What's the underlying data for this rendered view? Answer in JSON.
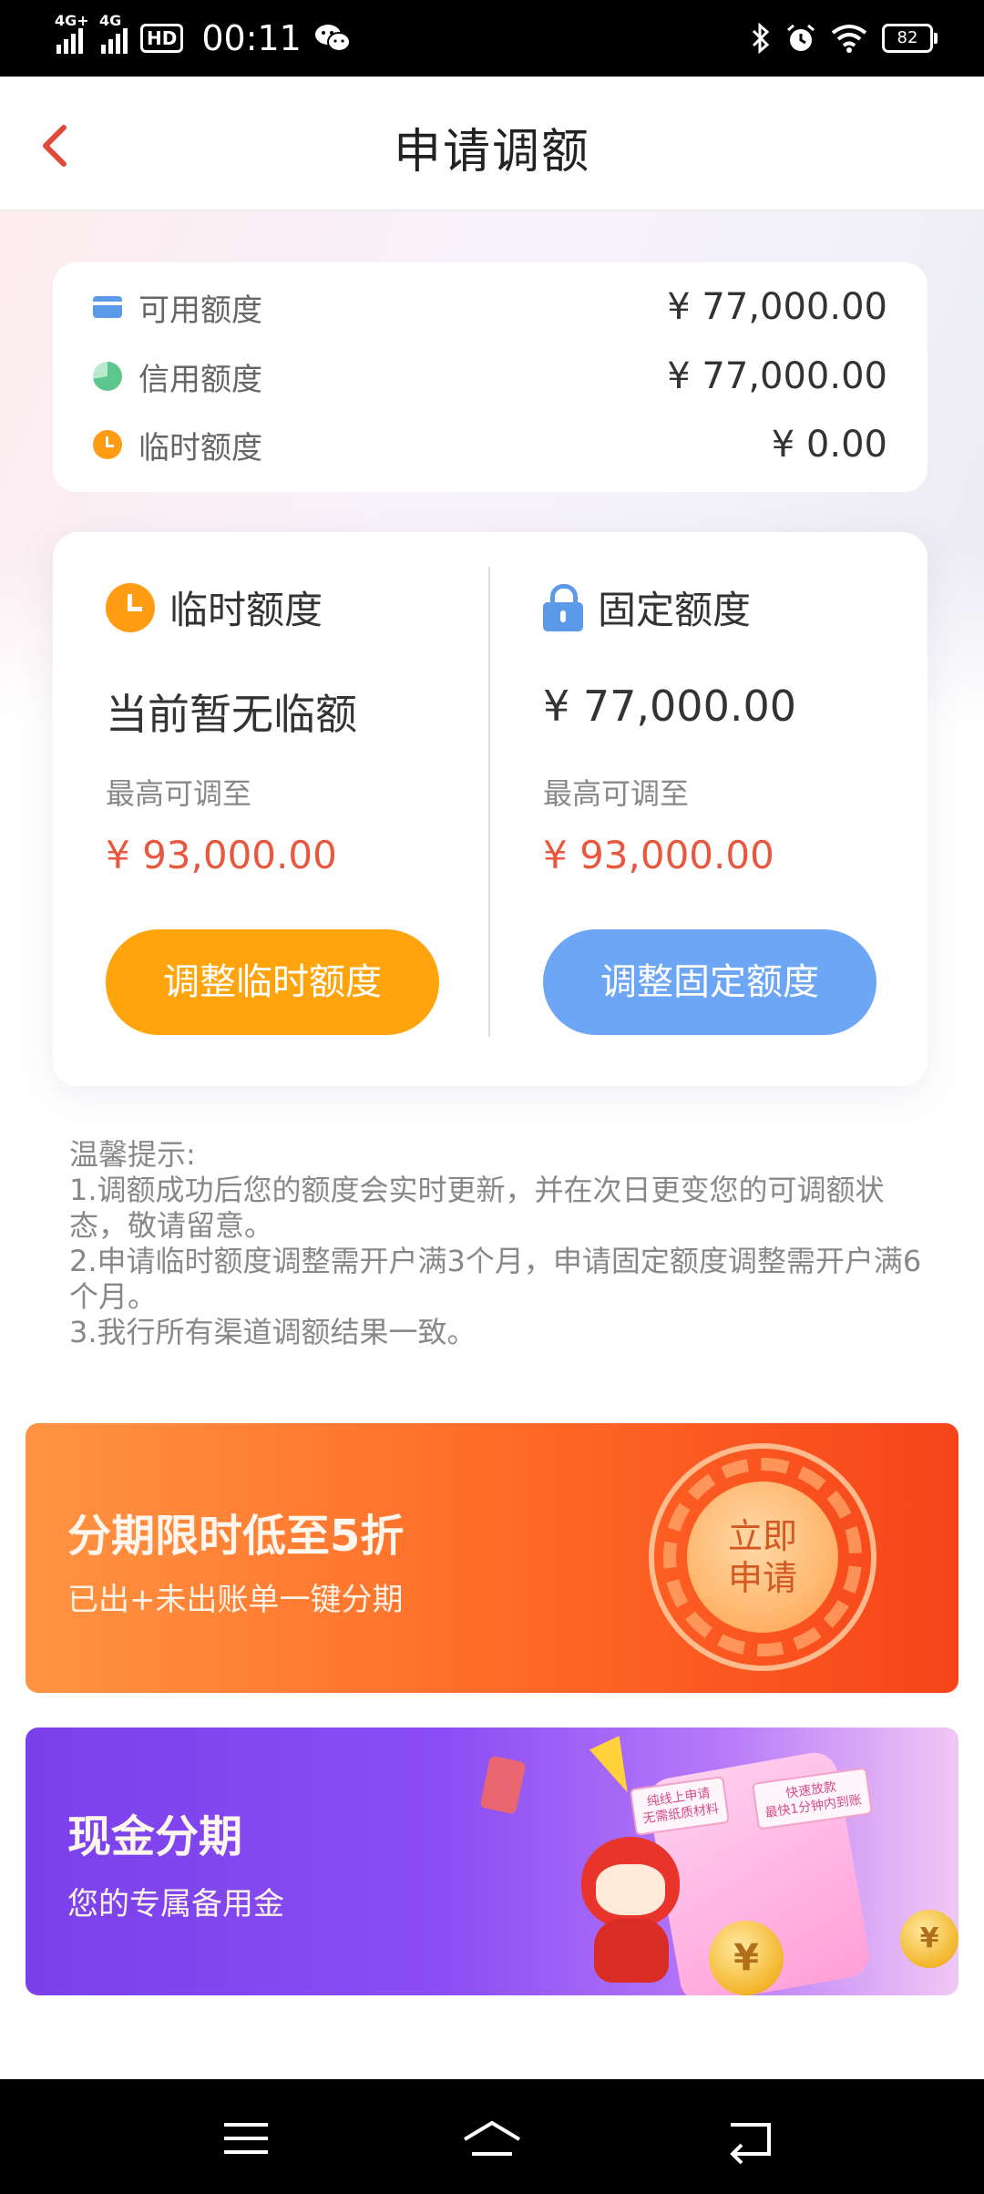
{
  "status_bar": {
    "signal1": "4G+",
    "signal2": "4G",
    "hd": "HD",
    "time": "00:11",
    "battery": "82"
  },
  "header": {
    "title": "申请调额"
  },
  "summary": [
    {
      "label": "可用额度",
      "value": "¥ 77,000.00",
      "icon": "card-icon"
    },
    {
      "label": "信用额度",
      "value": "¥ 77,000.00",
      "icon": "pie-chart-icon"
    },
    {
      "label": "临时额度",
      "value": "¥ 0.00",
      "icon": "clock-icon"
    }
  ],
  "temp": {
    "title": "临时额度",
    "status": "当前暂无临额",
    "max_label": "最高可调至",
    "max_value": "¥ 93,000.00",
    "button": "调整临时额度"
  },
  "fixed": {
    "title": "固定额度",
    "current": "¥ 77,000.00",
    "max_label": "最高可调至",
    "max_value": "¥ 93,000.00",
    "button": "调整固定额度"
  },
  "tips": {
    "title": "温馨提示:",
    "items": [
      "1.调额成功后您的额度会实时更新，并在次日更变您的可调额状态，敬请留意。",
      "2.申请临时额度调整需开户满3个月，申请固定额度调整需开户满6个月。",
      "3.我行所有渠道调额结果一致。"
    ]
  },
  "banner1": {
    "title": "分期限时低至5折",
    "subtitle": "已出+未出账单一键分期",
    "cta": [
      "立即",
      "申请"
    ]
  },
  "banner2": {
    "title": "现金分期",
    "subtitle": "您的专属备用金",
    "note1": [
      "纯线上申请",
      "无需纸质材料"
    ],
    "note2": [
      "快速放款",
      "最快1分钟内到账"
    ]
  },
  "colors": {
    "accent_red": "#e8573e",
    "orange": "#ffa40c",
    "blue": "#6ea6f6"
  }
}
